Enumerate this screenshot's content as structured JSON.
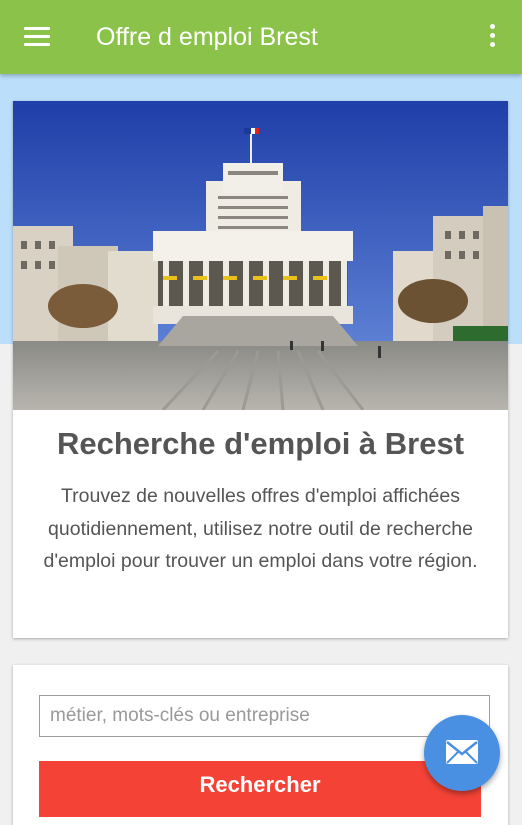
{
  "appbar": {
    "title": "Offre d emploi Brest",
    "menu_icon": "hamburger-menu-icon",
    "overflow_icon": "more-vert-icon",
    "color": "#8bc34a"
  },
  "hero": {
    "image": "brest-city-hall-square-photo"
  },
  "intro": {
    "title": "Recherche d'emploi à Brest",
    "text": "Trouvez de nouvelles offres d'emploi affichées quotidiennement, utilisez notre outil de recherche d'emploi pour trouver un emploi dans votre région."
  },
  "search": {
    "placeholder": "métier, mots-clés ou entreprise",
    "value": "",
    "button_label": "Rechercher",
    "button_color": "#f44336"
  },
  "fab": {
    "icon": "mail-icon",
    "color": "#4a90e2"
  },
  "colors": {
    "band": "#bbdefb"
  }
}
